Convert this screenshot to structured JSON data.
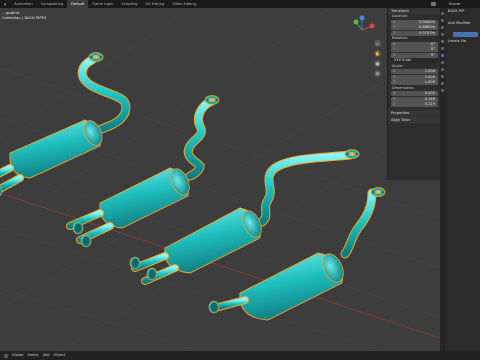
{
  "topbar": {
    "tabs": [
      "g",
      "Animation",
      "Compositing",
      "Default",
      "Game Logic",
      "Scripting",
      "UV Editing",
      "Video Editing"
    ],
    "active_tab": "Default",
    "scene": "Scene"
  },
  "viewport": {
    "view_name": "...graphic",
    "collection": "Collection | BACK PIPES"
  },
  "npanel": {
    "header": "Transform",
    "location_label": "Location:",
    "location": [
      {
        "axis": "X",
        "value": "0.0000m"
      },
      {
        "axis": "Y",
        "value": "0.6880m"
      },
      {
        "axis": "Z",
        "value": "0.0747m"
      }
    ],
    "rotation_label": "Rotation:",
    "rotation": [
      {
        "axis": "X",
        "value": "0°"
      },
      {
        "axis": "Y",
        "value": "0°"
      },
      {
        "axis": "Z",
        "value": "0°"
      }
    ],
    "rotation_mode": "XYZ Euler",
    "scale_label": "Scale:",
    "scale": [
      {
        "axis": "X",
        "value": "1.000"
      },
      {
        "axis": "Y",
        "value": "1.000"
      },
      {
        "axis": "Z",
        "value": "1.000"
      }
    ],
    "dimensions_label": "Dimensions:",
    "dimensions": [
      {
        "axis": "X",
        "value": "0.205"
      },
      {
        "axis": "Y",
        "value": "0.148"
      },
      {
        "axis": "Z",
        "value": "0.119"
      }
    ],
    "properties": "Properties",
    "align_tools": "Align Tools"
  },
  "properties_panel": {
    "object_name": "BACK PIP",
    "add_modifier": "Add Modifier",
    "sub": "Levels Vie"
  },
  "statusbar": {
    "items": [
      "Global",
      "Select",
      "Add",
      "Object"
    ]
  },
  "colors": {
    "mesh": "#19c7c7",
    "outline": "#f5a623",
    "brass": "#d6b86a",
    "grid_red": "#8a3a3a",
    "selected_blue": "#4772b3"
  }
}
